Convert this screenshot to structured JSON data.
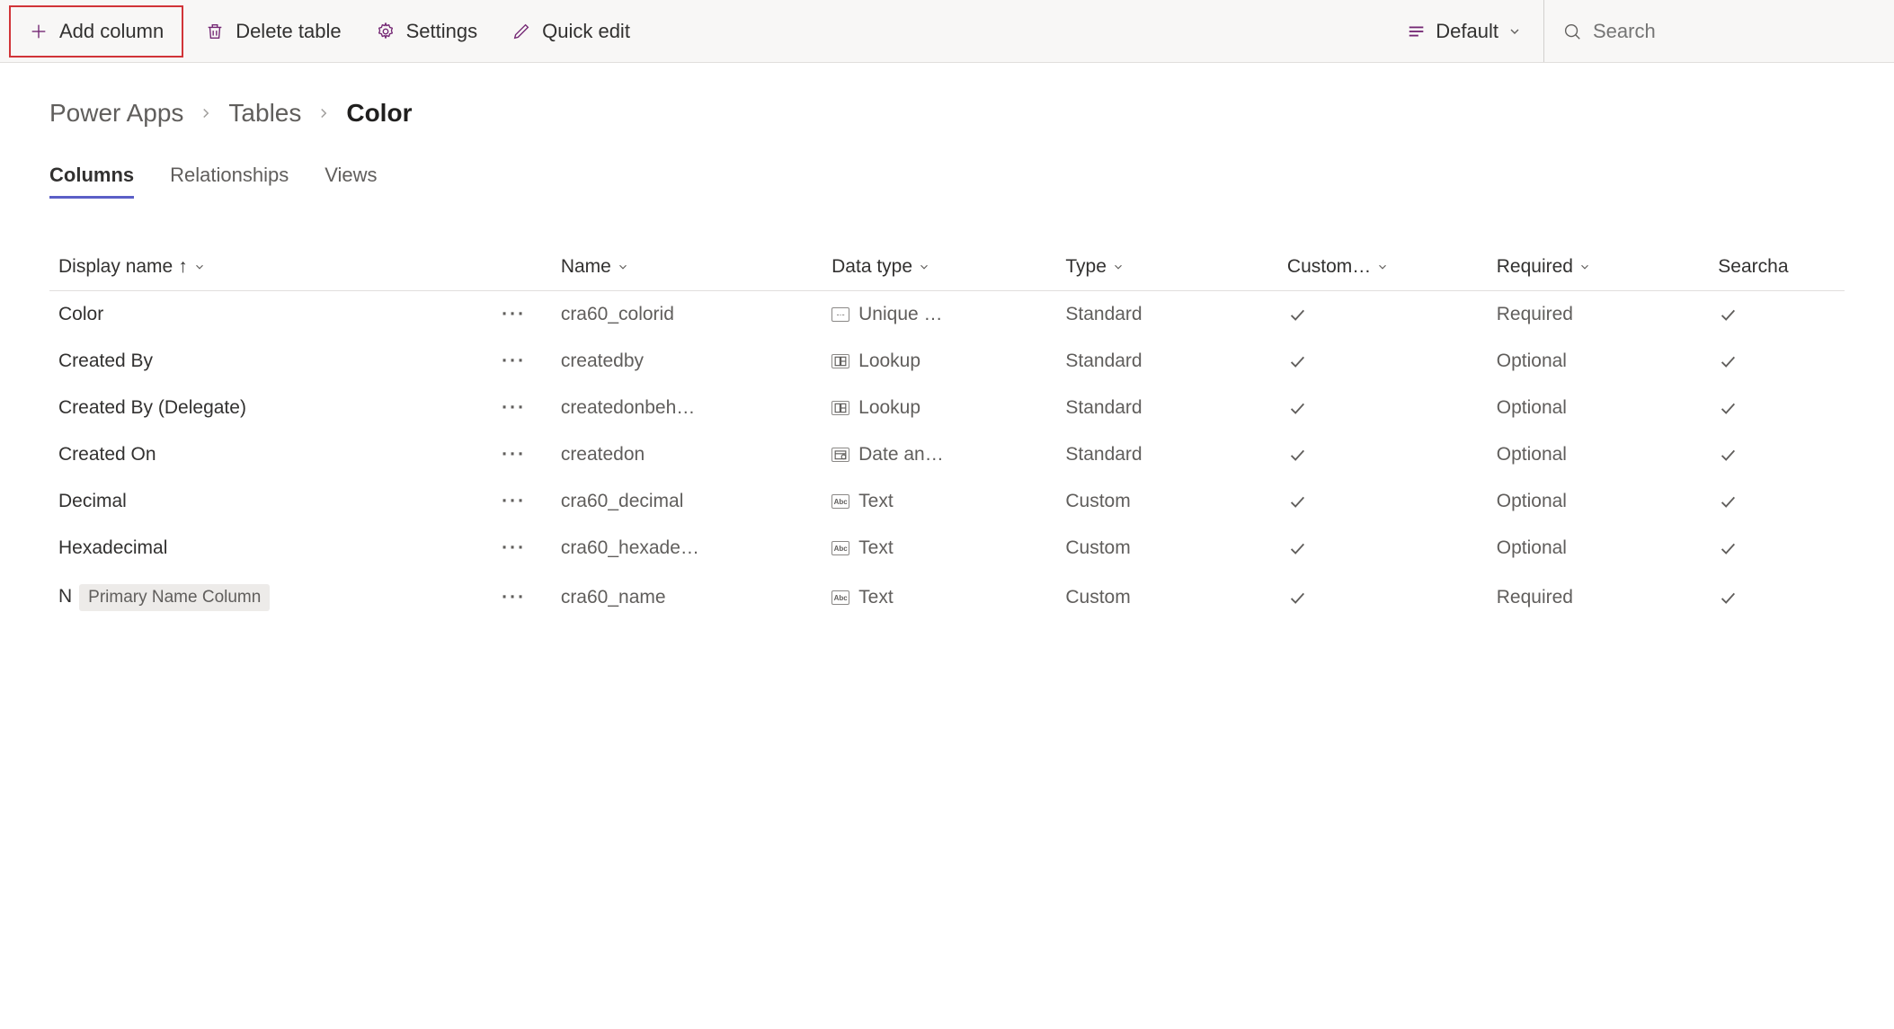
{
  "toolbar": {
    "add_column": "Add column",
    "delete_table": "Delete table",
    "settings": "Settings",
    "quick_edit": "Quick edit",
    "view_label": "Default",
    "search_placeholder": "Search"
  },
  "breadcrumb": {
    "root": "Power Apps",
    "tables": "Tables",
    "current": "Color"
  },
  "tabs": {
    "columns": "Columns",
    "relationships": "Relationships",
    "views": "Views"
  },
  "headers": {
    "display_name": "Display name",
    "name": "Name",
    "data_type": "Data type",
    "type": "Type",
    "custom": "Custom…",
    "required": "Required",
    "searchable": "Searcha"
  },
  "rows": [
    {
      "display": "Color",
      "badge": "",
      "name": "cra60_colorid",
      "datatype": "Unique …",
      "dticon": "id",
      "type": "Standard",
      "custom": "check",
      "required": "Required",
      "searchable": "check"
    },
    {
      "display": "Created By",
      "badge": "",
      "name": "createdby",
      "datatype": "Lookup",
      "dticon": "lookup",
      "type": "Standard",
      "custom": "check",
      "required": "Optional",
      "searchable": "check"
    },
    {
      "display": "Created By (Delegate)",
      "badge": "",
      "name": "createdonbeh…",
      "datatype": "Lookup",
      "dticon": "lookup",
      "type": "Standard",
      "custom": "check",
      "required": "Optional",
      "searchable": "check"
    },
    {
      "display": "Created On",
      "badge": "",
      "name": "createdon",
      "datatype": "Date an…",
      "dticon": "date",
      "type": "Standard",
      "custom": "check",
      "required": "Optional",
      "searchable": "check"
    },
    {
      "display": "Decimal",
      "badge": "",
      "name": "cra60_decimal",
      "datatype": "Text",
      "dticon": "text",
      "type": "Custom",
      "custom": "check",
      "required": "Optional",
      "searchable": "check"
    },
    {
      "display": "Hexadecimal",
      "badge": "",
      "name": "cra60_hexade…",
      "datatype": "Text",
      "dticon": "text",
      "type": "Custom",
      "custom": "check",
      "required": "Optional",
      "searchable": "check"
    },
    {
      "display": "N",
      "badge": "Primary Name Column",
      "name": "cra60_name",
      "datatype": "Text",
      "dticon": "text",
      "type": "Custom",
      "custom": "check",
      "required": "Required",
      "searchable": "check"
    }
  ]
}
